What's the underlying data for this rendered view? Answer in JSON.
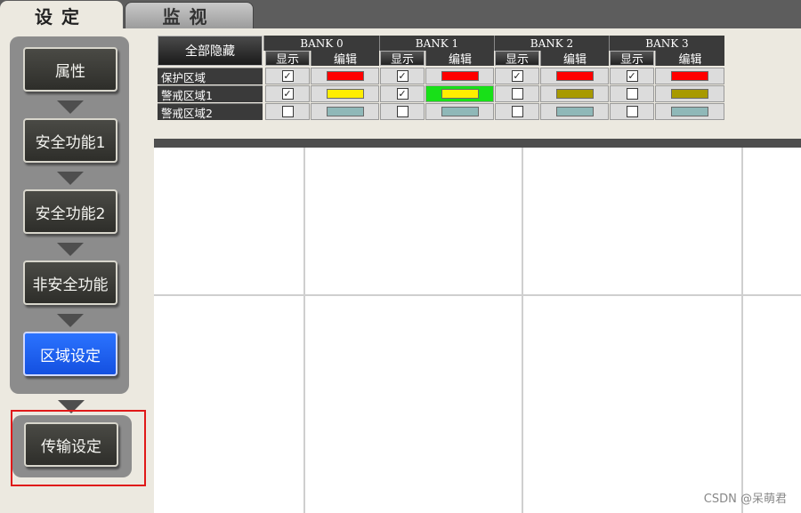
{
  "tabs": [
    {
      "label": "设定",
      "active": true
    },
    {
      "label": "监视",
      "active": false
    }
  ],
  "flow_steps": [
    {
      "label": "属性",
      "selected": false
    },
    {
      "label": "安全功能1",
      "selected": false
    },
    {
      "label": "安全功能2",
      "selected": false
    },
    {
      "label": "非安全功能",
      "selected": false
    },
    {
      "label": "区域设定",
      "selected": true
    }
  ],
  "transfer": {
    "label": "传输设定",
    "highlighted": true
  },
  "table": {
    "hide_all_label": "全部隐藏",
    "show_label": "显示",
    "edit_label": "编辑",
    "banks": [
      "BANK 0",
      "BANK 1",
      "BANK 2",
      "BANK 3"
    ],
    "rows": [
      {
        "label": "保护区域",
        "show": [
          true,
          true,
          true,
          true
        ],
        "colors": [
          "#ff0000",
          "#ff0000",
          "#ff0000",
          "#ff0000"
        ]
      },
      {
        "label": "警戒区域1",
        "show": [
          true,
          true,
          false,
          false
        ],
        "colors": [
          "#ffee00",
          "#ffee00",
          "#a89a00",
          "#a89a00"
        ]
      },
      {
        "label": "警戒区域2",
        "show": [
          false,
          false,
          false,
          false
        ],
        "colors": [
          "#8fb8b8",
          "#8fb8b8",
          "#8fb8b8",
          "#8fb8b8"
        ]
      }
    ],
    "highlighted_edit_cell": {
      "row": 1,
      "bank": 1
    }
  },
  "watermark": "CSDN @呆萌君"
}
